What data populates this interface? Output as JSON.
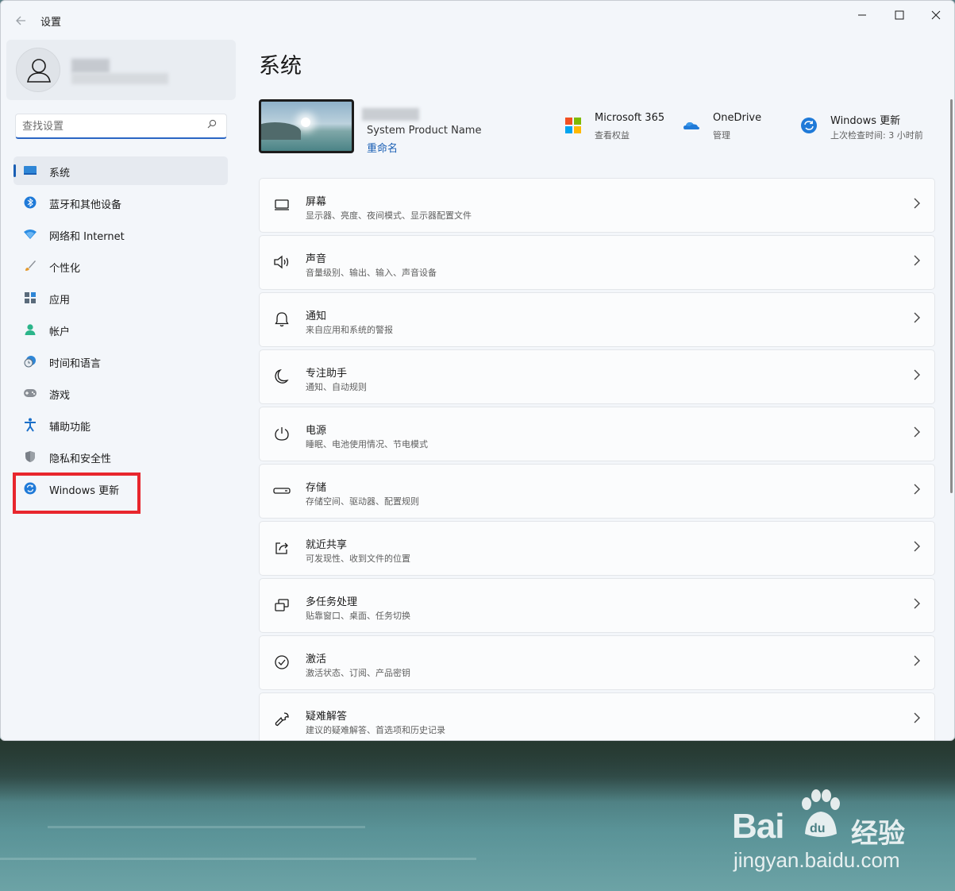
{
  "window": {
    "app_title": "设置",
    "controls": {
      "minimize": "—",
      "maximize": "☐",
      "close": "✕"
    }
  },
  "search": {
    "placeholder": "查找设置"
  },
  "sidebar": {
    "items": [
      {
        "label": "系统",
        "icon": "display-icon",
        "active": true
      },
      {
        "label": "蓝牙和其他设备",
        "icon": "bluetooth-icon"
      },
      {
        "label": "网络和 Internet",
        "icon": "wifi-icon"
      },
      {
        "label": "个性化",
        "icon": "brush-icon"
      },
      {
        "label": "应用",
        "icon": "apps-icon"
      },
      {
        "label": "帐户",
        "icon": "account-icon"
      },
      {
        "label": "时间和语言",
        "icon": "clock-globe-icon"
      },
      {
        "label": "游戏",
        "icon": "gamepad-icon"
      },
      {
        "label": "辅助功能",
        "icon": "accessibility-icon"
      },
      {
        "label": "隐私和安全性",
        "icon": "shield-icon"
      },
      {
        "label": "Windows 更新",
        "icon": "windows-update-icon"
      }
    ]
  },
  "main": {
    "title": "系统",
    "device": {
      "name": "System Product Name",
      "rename": "重命名"
    },
    "quick": [
      {
        "title": "Microsoft 365",
        "sub": "查看权益",
        "icon": "microsoft-logo-icon"
      },
      {
        "title": "OneDrive",
        "sub": "管理",
        "icon": "onedrive-cloud-icon"
      },
      {
        "title": "Windows 更新",
        "sub": "上次检查时间: 3 小时前",
        "icon": "windows-update-icon"
      }
    ],
    "cards": [
      {
        "title": "屏幕",
        "sub": "显示器、亮度、夜间模式、显示器配置文件",
        "icon": "monitor-icon"
      },
      {
        "title": "声音",
        "sub": "音量级别、输出、输入、声音设备",
        "icon": "speaker-icon"
      },
      {
        "title": "通知",
        "sub": "来自应用和系统的警报",
        "icon": "bell-icon"
      },
      {
        "title": "专注助手",
        "sub": "通知、自动规则",
        "icon": "moon-icon"
      },
      {
        "title": "电源",
        "sub": "睡眠、电池使用情况、节电模式",
        "icon": "power-icon"
      },
      {
        "title": "存储",
        "sub": "存储空间、驱动器、配置规则",
        "icon": "storage-icon"
      },
      {
        "title": "就近共享",
        "sub": "可发现性、收到文件的位置",
        "icon": "share-icon"
      },
      {
        "title": "多任务处理",
        "sub": "贴靠窗口、桌面、任务切换",
        "icon": "multitask-icon"
      },
      {
        "title": "激活",
        "sub": "激活状态、订阅、产品密钥",
        "icon": "check-circle-icon"
      },
      {
        "title": "疑难解答",
        "sub": "建议的疑难解答、首选项和历史记录",
        "icon": "wrench-icon"
      }
    ]
  },
  "watermark": {
    "brand": "Bai",
    "brand_cn": "经验",
    "url": "jingyan.baidu.com"
  },
  "colors": {
    "accent": "#1a5fb4",
    "highlight": "#e8262d",
    "background": "#f3f6fa"
  }
}
